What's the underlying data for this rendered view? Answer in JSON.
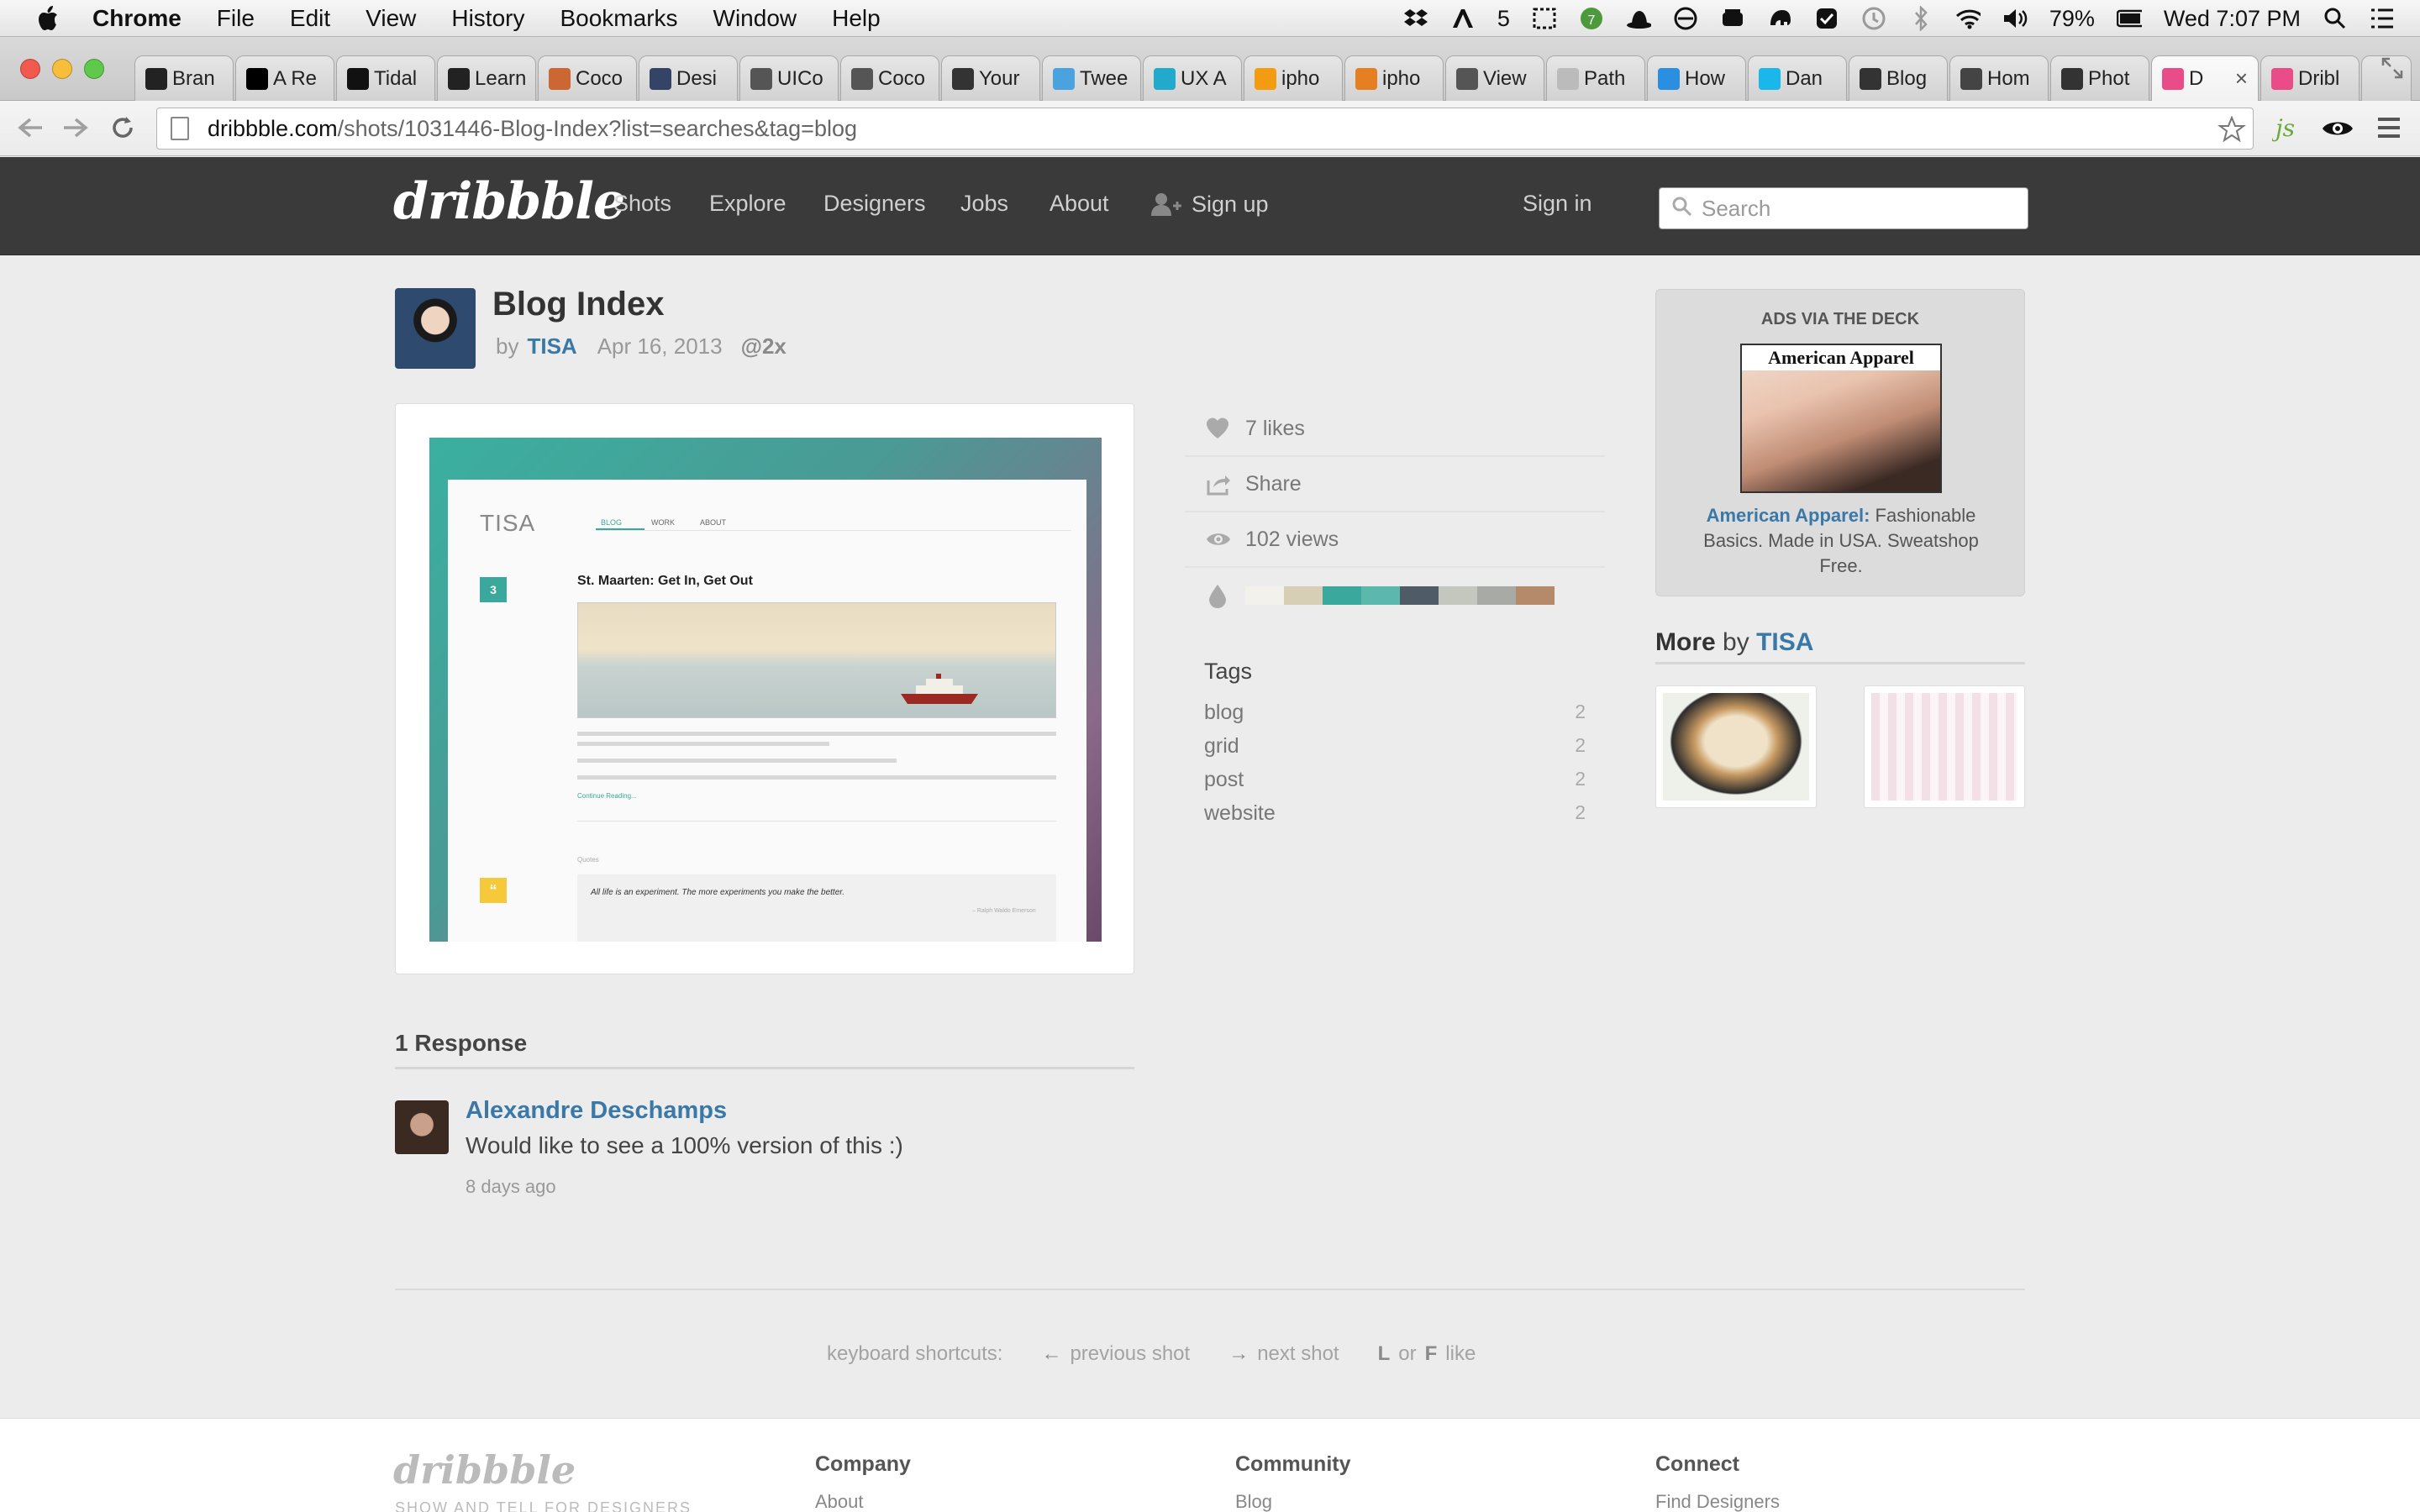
{
  "mac_menubar": {
    "app_name": "Chrome",
    "menus": [
      "File",
      "Edit",
      "View",
      "History",
      "Bookmarks",
      "Window",
      "Help"
    ],
    "adobe_count": "5",
    "battery": "79%",
    "clock": "Wed 7:07 PM"
  },
  "browser": {
    "tabs": [
      {
        "label": "Bran",
        "icon": "github-icon",
        "color": "#222222"
      },
      {
        "label": "A Re",
        "icon": "medium-icon",
        "color": "#000000"
      },
      {
        "label": "Tidal",
        "icon": "tidal-icon",
        "color": "#111111"
      },
      {
        "label": "Learn",
        "icon": "framer-icon",
        "color": "#222222"
      },
      {
        "label": "Coco",
        "icon": "cocoa-icon",
        "color": "#cc6633"
      },
      {
        "label": "Desi",
        "icon": "design-icon",
        "color": "#334466"
      },
      {
        "label": "UICo",
        "icon": "apple-icon",
        "color": "#555555"
      },
      {
        "label": "Coco",
        "icon": "apple-icon",
        "color": "#555555"
      },
      {
        "label": "Your",
        "icon": "a-icon",
        "color": "#333333"
      },
      {
        "label": "Twee",
        "icon": "tweetdeck-icon",
        "color": "#4aa3df"
      },
      {
        "label": "UX A",
        "icon": "ux-icon",
        "color": "#22aacc"
      },
      {
        "label": "ipho",
        "icon": "iphone-icon",
        "color": "#f39c12"
      },
      {
        "label": "ipho",
        "icon": "stack-icon",
        "color": "#e67e22"
      },
      {
        "label": "View",
        "icon": "apple-icon",
        "color": "#555555"
      },
      {
        "label": "Path",
        "icon": "dt-icon",
        "color": "#bbbbbb"
      },
      {
        "label": "How",
        "icon": "quote-icon",
        "color": "#2a8fe0"
      },
      {
        "label": "Dan",
        "icon": "v-icon",
        "color": "#1ab7ea"
      },
      {
        "label": "Blog",
        "icon": "tools-icon",
        "color": "#333333"
      },
      {
        "label": "Hom",
        "icon": "bc-icon",
        "color": "#444444"
      },
      {
        "label": "Phot",
        "icon": "fork-icon",
        "color": "#333333"
      },
      {
        "label": "D",
        "icon": "dribbble-icon",
        "color": "#ea4c89",
        "active": true
      },
      {
        "label": "Dribl",
        "icon": "dribbble-icon",
        "color": "#ea4c89"
      }
    ],
    "url_host": "dribbble.com",
    "url_path": "/shots/1031446-Blog-Index?list=searches&tag=blog"
  },
  "site": {
    "logo": "dribbble",
    "nav": [
      "Shots",
      "Explore",
      "Designers",
      "Jobs",
      "About"
    ],
    "signup": "Sign up",
    "signin": "Sign in",
    "search_placeholder": "Search"
  },
  "shot": {
    "title": "Blog Index",
    "by_label": "by",
    "author": "TISA",
    "date": "Apr 16, 2013",
    "resolution": "@2x",
    "preview": {
      "blog_name": "TISA",
      "nav": [
        "BLOG",
        "WORK",
        "ABOUT"
      ],
      "post_title": "St. Maarten: Get In, Get Out",
      "post_badge": "3",
      "continue": "Continue Reading...",
      "quote_label": "Quotes",
      "quote": "All life is an experiment. The more experiments you make the better.",
      "quote_author": "– Ralph Waldo Emerson",
      "quote_badge": "“"
    }
  },
  "stats": {
    "likes": "7 likes",
    "share": "Share",
    "views": "102 views",
    "palette": [
      "#f3f1ec",
      "#d6cfb6",
      "#3aa89c",
      "#5cb8ad",
      "#4f5b66",
      "#c4c7be",
      "#a8aaa6",
      "#b48a6a"
    ]
  },
  "tags": {
    "title": "Tags",
    "items": [
      {
        "name": "blog",
        "count": "2"
      },
      {
        "name": "grid",
        "count": "2"
      },
      {
        "name": "post",
        "count": "2"
      },
      {
        "name": "website",
        "count": "2"
      }
    ]
  },
  "ad": {
    "heading": "ADS VIA THE DECK",
    "brand": "American Apparel",
    "link": "American Apparel:",
    "text": "Fashionable Basics. Made in USA. Sweatshop Free."
  },
  "more": {
    "label": "More",
    "by": "by",
    "author": "TISA"
  },
  "responses": {
    "heading": "1 Response",
    "items": [
      {
        "name": "Alexandre Deschamps",
        "text": "Would like to see a 100% version of this :)",
        "time": "8 days ago"
      }
    ]
  },
  "shortcuts": {
    "label": "keyboard shortcuts:",
    "prev_key": "←",
    "prev": "previous shot",
    "next_key": "→",
    "next": "next shot",
    "like_key1": "L",
    "like_or": "or",
    "like_key2": "F",
    "like": "like"
  },
  "footer": {
    "logo": "dribbble",
    "tagline": "SHOW AND TELL FOR DESIGNERS",
    "columns": [
      {
        "title": "Company",
        "first_link": "About"
      },
      {
        "title": "Community",
        "first_link": "Blog"
      },
      {
        "title": "Connect",
        "first_link": "Find Designers"
      }
    ]
  }
}
